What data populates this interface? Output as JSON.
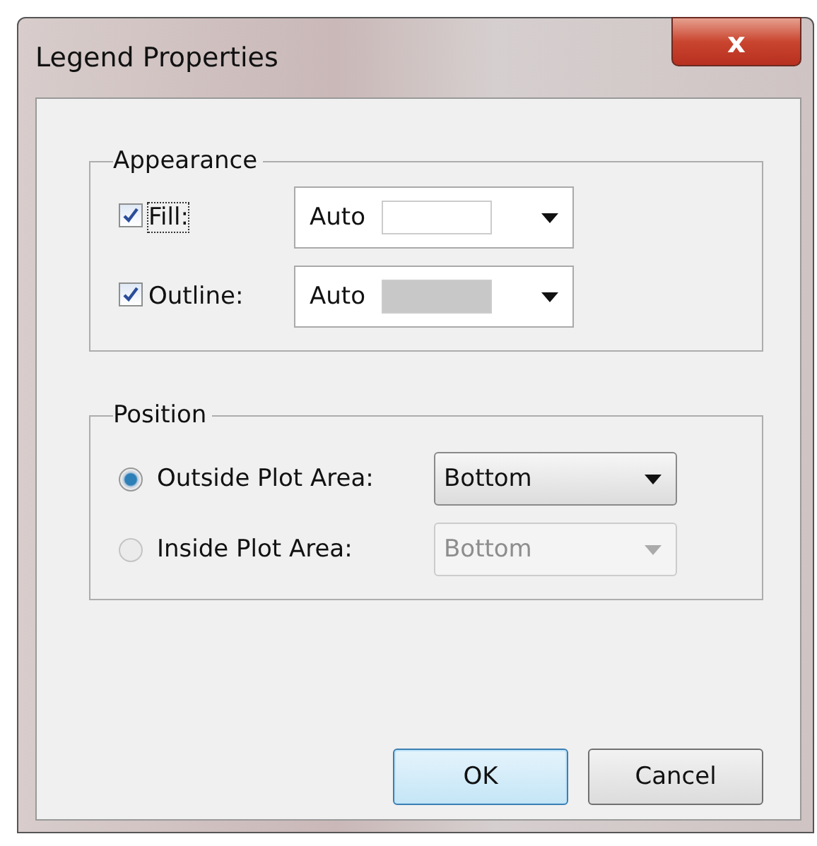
{
  "window": {
    "title": "Legend Properties",
    "close": "x"
  },
  "appearance": {
    "title": "Appearance",
    "rows": [
      {
        "label": "Fill:",
        "checked": true,
        "focused": true,
        "value": "Auto",
        "color": "#ffffff"
      },
      {
        "label": "Outline:",
        "checked": true,
        "focused": false,
        "value": "Auto",
        "color": "#c8c8c8"
      }
    ]
  },
  "position": {
    "title": "Position",
    "options": [
      {
        "label": "Outside Plot Area:",
        "selected": true,
        "value": "Bottom",
        "disabled": false
      },
      {
        "label": "Inside Plot Area:",
        "selected": false,
        "value": "Bottom",
        "disabled": true
      }
    ]
  },
  "buttons": [
    {
      "label": "OK",
      "default": true
    },
    {
      "label": "Cancel",
      "default": false
    }
  ]
}
